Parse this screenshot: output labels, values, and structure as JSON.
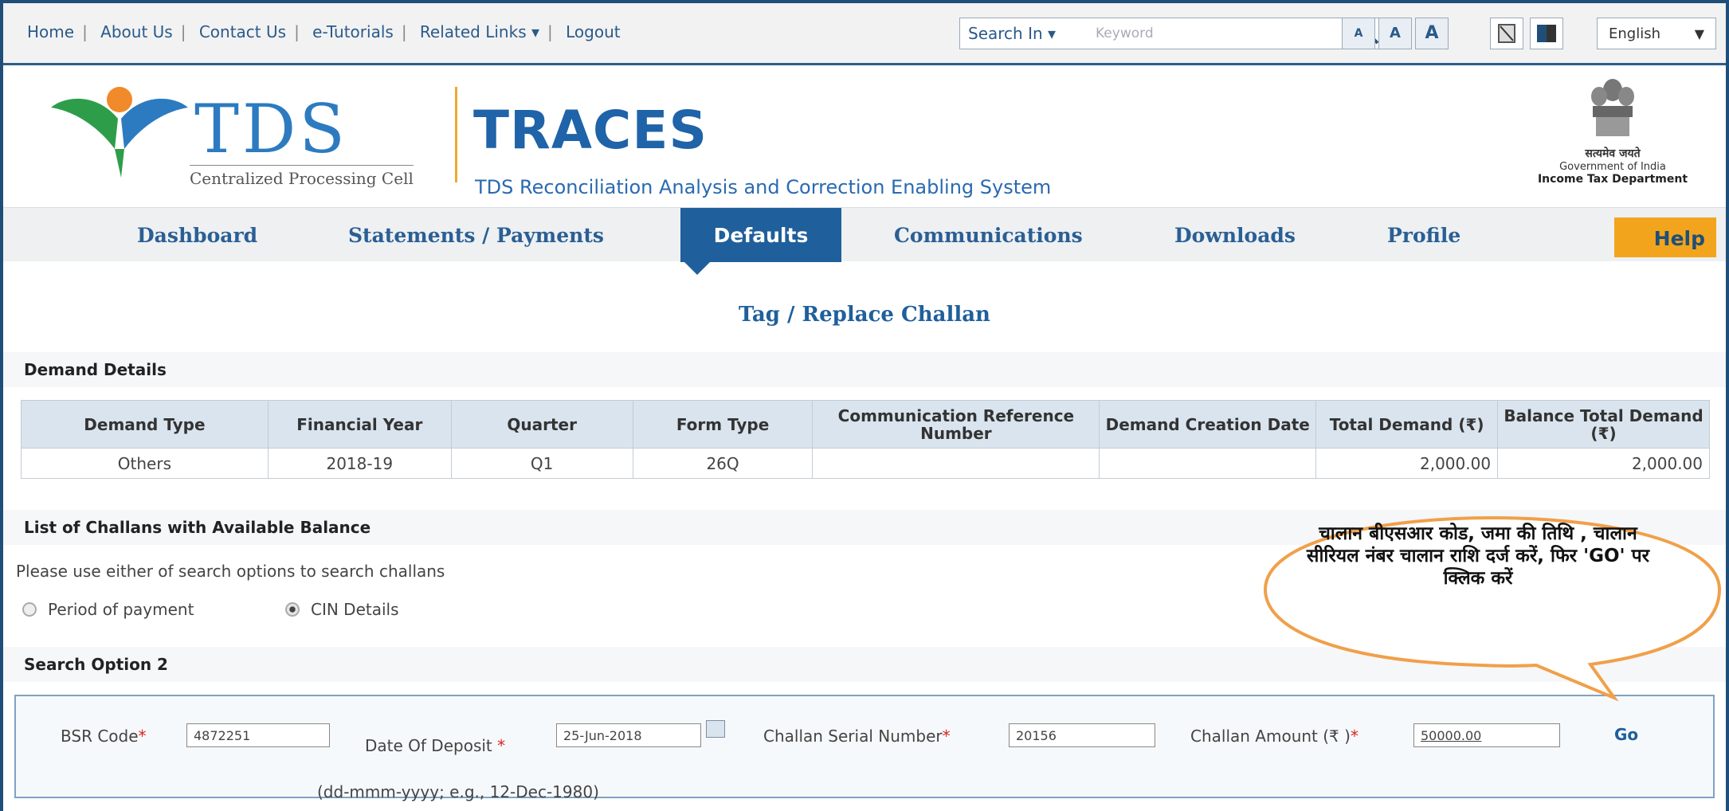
{
  "top_links": [
    "Home",
    "About Us",
    "Contact Us",
    "e-Tutorials",
    "Related Links ▾",
    "Logout"
  ],
  "search": {
    "label": "Search In ▾",
    "placeholder": "Keyword"
  },
  "font_buttons": [
    "A",
    "A",
    "A"
  ],
  "language": "English",
  "brand": {
    "tds": "TDS",
    "cpc": "Centralized Processing Cell",
    "traces": "TRACES",
    "traces_full": "TDS Reconciliation Analysis and Correction Enabling System",
    "emblem_hindi": "सत्यमेव जयते",
    "govt": "Government of India",
    "dept": "Income Tax Department"
  },
  "nav": {
    "dashboard": "Dashboard",
    "statements": "Statements / Payments",
    "defaults": "Defaults",
    "communications": "Communications",
    "downloads": "Downloads",
    "profile": "Profile",
    "help": "Help"
  },
  "page_title": "Tag / Replace Challan",
  "demand_section": "Demand Details",
  "demand_table": {
    "headers": [
      "Demand Type",
      "Financial Year",
      "Quarter",
      "Form Type",
      "Communication Reference Number",
      "Demand Creation Date",
      "Total Demand (₹)",
      "Balance Total Demand (₹)"
    ],
    "row": [
      "Others",
      "2018-19",
      "Q1",
      "26Q",
      "",
      "",
      "2,000.00",
      "2,000.00"
    ]
  },
  "challans_section": "List of Challans with Available Balance",
  "hint": "Please use either of search options to search challans",
  "radio": {
    "period": "Period of payment",
    "cin": "CIN Details"
  },
  "search_option": "Search Option 2",
  "form": {
    "bsr_label": "BSR Code",
    "bsr_value": "4872251",
    "date_label": "Date Of Deposit",
    "date_value": "25-Jun-2018",
    "date_hint": "(dd-mmm-yyyy; e.g., 12-Dec-1980)",
    "serial_label": "Challan Serial Number",
    "serial_value": "20156",
    "amount_label": "Challan Amount (₹ )",
    "amount_value": "50000.00",
    "go": "Go"
  },
  "callout": "चालान बीएसआर कोड, जमा की तिथि , चालान सीरियल नंबर चालान राशि दर्ज करें, फिर 'GO' पर क्लिक करें",
  "colors": {
    "nav_active": "#1f5f9c",
    "help": "#f2a51c",
    "callout_border": "#f0a04a"
  }
}
